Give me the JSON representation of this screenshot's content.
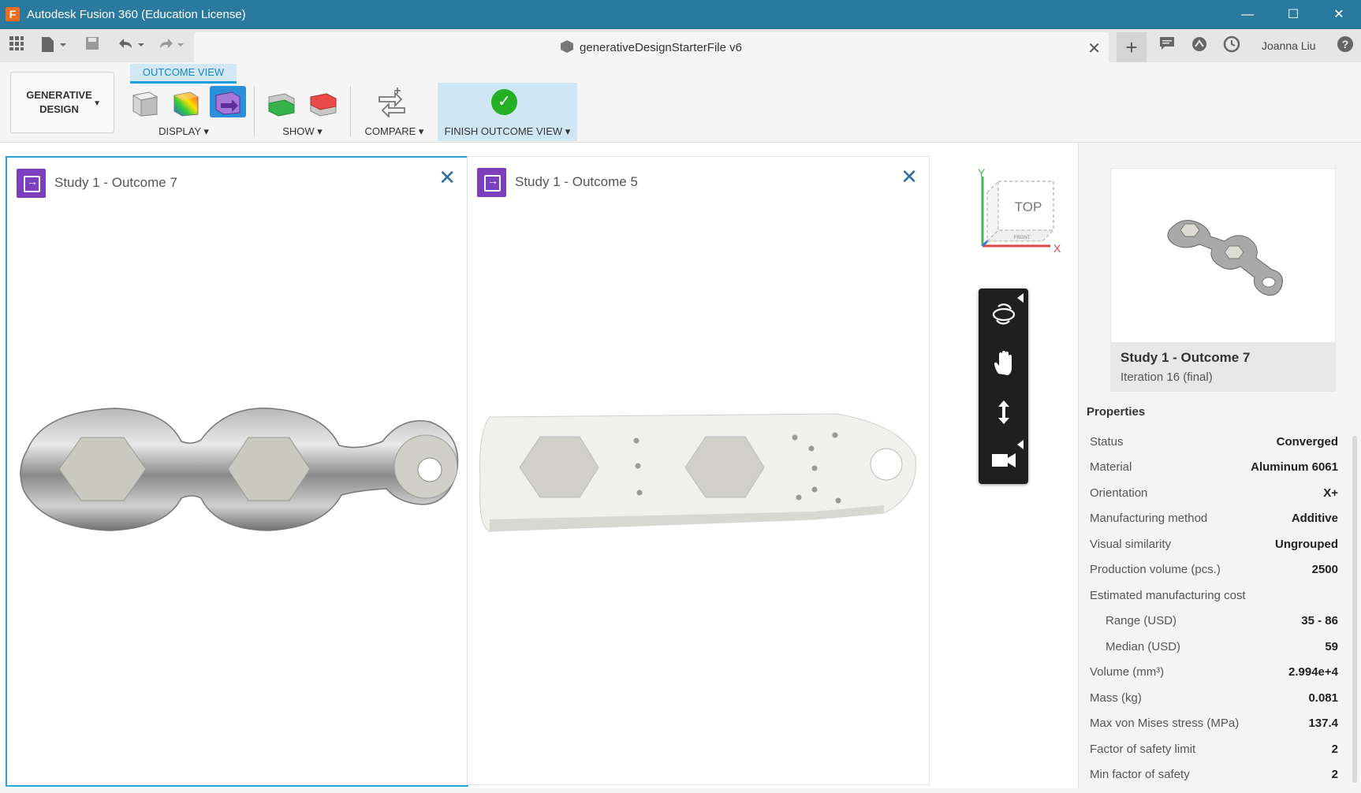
{
  "app": {
    "logo_letter": "F",
    "title": "Autodesk Fusion 360 (Education License)"
  },
  "window_controls": {
    "minimize": "—",
    "maximize": "☐",
    "close": "✕"
  },
  "tabbar": {
    "doc_title": "generativeDesignStarterFile v6",
    "close_label": "✕",
    "plus_label": "+",
    "user": "Joanna Liu",
    "help": "?"
  },
  "ribbon": {
    "workspace_line1": "GENERATIVE",
    "workspace_line2": "DESIGN",
    "active_tab": "OUTCOME VIEW",
    "groups": {
      "display": "DISPLAY ▾",
      "show": "SHOW ▾",
      "compare": "COMPARE ▾",
      "finish": "FINISH OUTCOME VIEW ▾"
    }
  },
  "viewports": [
    {
      "title": "Study 1 - Outcome 7",
      "close": "✕"
    },
    {
      "title": "Study 1 - Outcome 5",
      "close": "✕"
    }
  ],
  "viewcube": {
    "face": "TOP",
    "front": "FRONT",
    "axis_y": "Y",
    "axis_x": "X"
  },
  "panel": {
    "thumb_title": "Study 1 - Outcome 7",
    "thumb_sub": "Iteration 16 (final)",
    "properties_header": "Properties",
    "properties": [
      {
        "k": "Status",
        "v": "Converged"
      },
      {
        "k": "Material",
        "v": "Aluminum 6061"
      },
      {
        "k": "Orientation",
        "v": "X+"
      },
      {
        "k": "Manufacturing method",
        "v": "Additive"
      },
      {
        "k": "Visual similarity",
        "v": "Ungrouped"
      },
      {
        "k": "Production volume (pcs.)",
        "v": "2500"
      },
      {
        "k": "Estimated manufacturing cost",
        "v": ""
      },
      {
        "k": "Range (USD)",
        "v": "35 - 86"
      },
      {
        "k": "Median (USD)",
        "v": "59"
      },
      {
        "k": "Volume (mm³)",
        "v": "2.994e+4"
      },
      {
        "k": "Mass (kg)",
        "v": "0.081"
      },
      {
        "k": "Max von Mises stress (MPa)",
        "v": "137.4"
      },
      {
        "k": "Factor of safety limit",
        "v": "2"
      },
      {
        "k": "Min factor of safety",
        "v": "2"
      }
    ]
  }
}
